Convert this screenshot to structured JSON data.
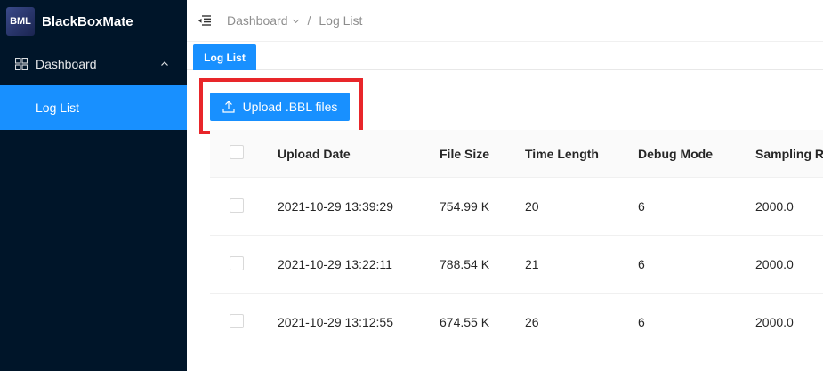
{
  "app": {
    "title": "BlackBoxMate",
    "logo_text": "BML"
  },
  "sidebar": {
    "menu": [
      {
        "label": "Dashboard",
        "icon": "dashboard-icon",
        "expanded": true,
        "children": [
          {
            "label": "Log List",
            "selected": true
          }
        ]
      }
    ]
  },
  "header": {
    "breadcrumb": [
      "Dashboard",
      "Log List"
    ],
    "separator": "/"
  },
  "tabs": [
    {
      "label": "Log List",
      "active": true
    }
  ],
  "toolbar": {
    "upload_label": "Upload .BBL files",
    "upload_icon": "upload-icon"
  },
  "table": {
    "columns": [
      "Upload Date",
      "File Size",
      "Time Length",
      "Debug Mode",
      "Sampling Ra"
    ],
    "rows": [
      {
        "upload_date": "2021-10-29 13:39:29",
        "file_size": "754.99 K",
        "time_length": "20",
        "debug_mode": "6",
        "sampling_rate": "2000.0"
      },
      {
        "upload_date": "2021-10-29 13:22:11",
        "file_size": "788.54 K",
        "time_length": "21",
        "debug_mode": "6",
        "sampling_rate": "2000.0"
      },
      {
        "upload_date": "2021-10-29 13:12:55",
        "file_size": "674.55 K",
        "time_length": "26",
        "debug_mode": "6",
        "sampling_rate": "2000.0"
      }
    ]
  },
  "colors": {
    "sidebar_bg": "#001529",
    "accent": "#1890ff",
    "highlight": "#e8262a"
  }
}
